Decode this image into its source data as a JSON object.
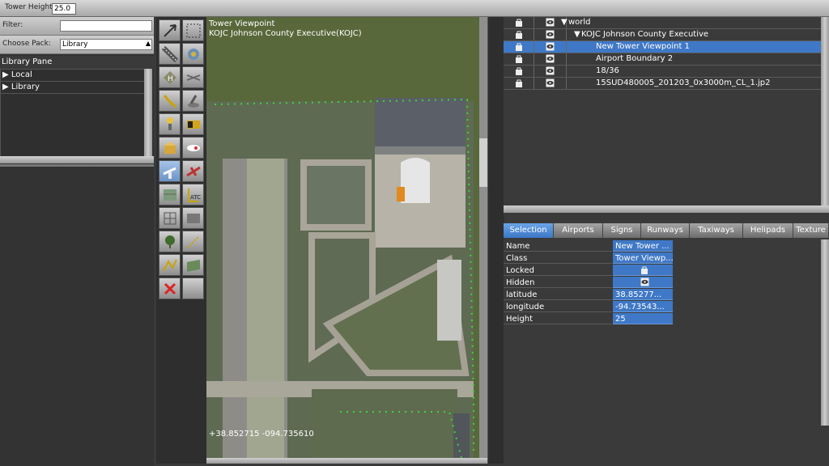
{
  "toolbar": {
    "tower_height_label": "Tower Height",
    "tower_height_value": "25.0"
  },
  "left_panel": {
    "filter_label": "Filter:",
    "filter_value": "",
    "choose_pack_label": "Choose Pack:",
    "choose_pack_value": "Library",
    "library_pane_title": "Library Pane",
    "tree": [
      {
        "label": "Local"
      },
      {
        "label": "Library"
      }
    ]
  },
  "tools": [
    {
      "name": "vertex-tool-icon"
    },
    {
      "name": "marquee-tool-icon"
    },
    {
      "name": "runway-tool-icon"
    },
    {
      "name": "beacon-tool-icon"
    },
    {
      "name": "helipad-tool-icon"
    },
    {
      "name": "boundary-tool-icon"
    },
    {
      "name": "taxiline-tool-icon"
    },
    {
      "name": "windsock-tool-icon"
    },
    {
      "name": "light-tool-icon"
    },
    {
      "name": "sign-tool-icon"
    },
    {
      "name": "object-tool-icon"
    },
    {
      "name": "startlocation-tool-icon"
    },
    {
      "name": "tower-viewpoint-tool-icon"
    },
    {
      "name": "plane-tool-icon"
    },
    {
      "name": "facade-tool-icon"
    },
    {
      "name": "atc-tool-icon"
    },
    {
      "name": "string-tool-icon"
    },
    {
      "name": "polygon-tool-icon"
    },
    {
      "name": "forest-tool-icon"
    },
    {
      "name": "exclusion-tool-icon"
    },
    {
      "name": "line-tool-icon"
    },
    {
      "name": "draped-tool-icon"
    },
    {
      "name": "delete-tool-icon"
    },
    {
      "name": "blank-tool-icon"
    }
  ],
  "map": {
    "title_line1": "Tower Viewpoint",
    "title_line2": "KOJC Johnson County Executive(KOJC)",
    "coords": "+38.852715 -094.735610"
  },
  "hierarchy": {
    "rows": [
      {
        "label": "world",
        "arrow": "▼"
      },
      {
        "label": "KOJC Johnson County Executive",
        "arrow": "▼"
      },
      {
        "label": "New Tower Viewpoint 1",
        "arrow": ""
      },
      {
        "label": "Airport Boundary 2",
        "arrow": ""
      },
      {
        "label": "18/36",
        "arrow": ""
      },
      {
        "label": "15SUD480005_201203_0x3000m_CL_1.jp2",
        "arrow": ""
      }
    ]
  },
  "tabs": [
    "Selection",
    "Airports",
    "Signs",
    "Runways",
    "Taxiways",
    "Helipads",
    "Texture"
  ],
  "properties": [
    {
      "key": "Name",
      "value": "New Tower ..."
    },
    {
      "key": "Class",
      "value": "Tower Viewp..."
    },
    {
      "key": "Locked",
      "value": ""
    },
    {
      "key": "Hidden",
      "value": ""
    },
    {
      "key": "latitude",
      "value": "38.85277..."
    },
    {
      "key": "longitude",
      "value": "-94.73543..."
    },
    {
      "key": "Height",
      "value": "25"
    }
  ],
  "colors": {
    "selection": "#3f78c6",
    "map_grass": "#58683a",
    "boundary": "#3fd23f"
  }
}
